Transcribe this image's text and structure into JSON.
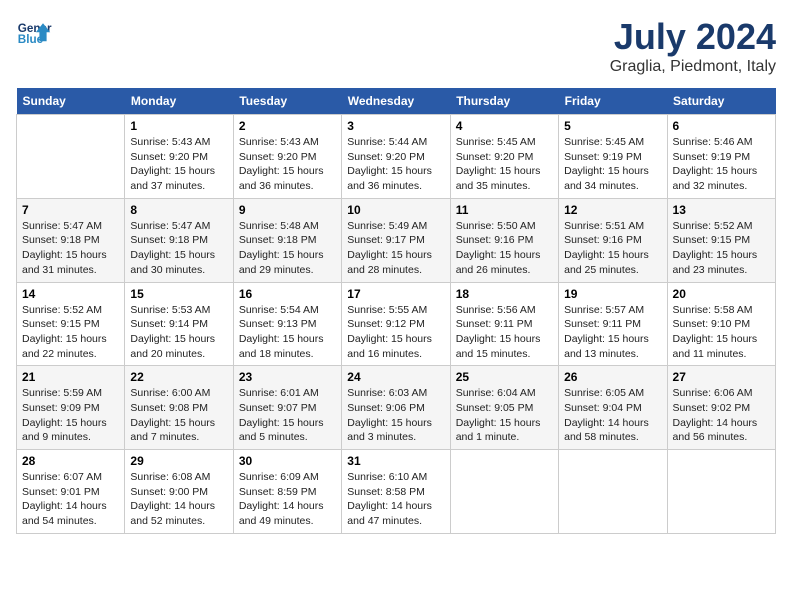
{
  "header": {
    "logo_line1": "General",
    "logo_line2": "Blue",
    "title": "July 2024",
    "subtitle": "Graglia, Piedmont, Italy"
  },
  "days_of_week": [
    "Sunday",
    "Monday",
    "Tuesday",
    "Wednesday",
    "Thursday",
    "Friday",
    "Saturday"
  ],
  "weeks": [
    [
      {
        "day": "",
        "info": ""
      },
      {
        "day": "1",
        "info": "Sunrise: 5:43 AM\nSunset: 9:20 PM\nDaylight: 15 hours\nand 37 minutes."
      },
      {
        "day": "2",
        "info": "Sunrise: 5:43 AM\nSunset: 9:20 PM\nDaylight: 15 hours\nand 36 minutes."
      },
      {
        "day": "3",
        "info": "Sunrise: 5:44 AM\nSunset: 9:20 PM\nDaylight: 15 hours\nand 36 minutes."
      },
      {
        "day": "4",
        "info": "Sunrise: 5:45 AM\nSunset: 9:20 PM\nDaylight: 15 hours\nand 35 minutes."
      },
      {
        "day": "5",
        "info": "Sunrise: 5:45 AM\nSunset: 9:19 PM\nDaylight: 15 hours\nand 34 minutes."
      },
      {
        "day": "6",
        "info": "Sunrise: 5:46 AM\nSunset: 9:19 PM\nDaylight: 15 hours\nand 32 minutes."
      }
    ],
    [
      {
        "day": "7",
        "info": "Sunrise: 5:47 AM\nSunset: 9:18 PM\nDaylight: 15 hours\nand 31 minutes."
      },
      {
        "day": "8",
        "info": "Sunrise: 5:47 AM\nSunset: 9:18 PM\nDaylight: 15 hours\nand 30 minutes."
      },
      {
        "day": "9",
        "info": "Sunrise: 5:48 AM\nSunset: 9:18 PM\nDaylight: 15 hours\nand 29 minutes."
      },
      {
        "day": "10",
        "info": "Sunrise: 5:49 AM\nSunset: 9:17 PM\nDaylight: 15 hours\nand 28 minutes."
      },
      {
        "day": "11",
        "info": "Sunrise: 5:50 AM\nSunset: 9:16 PM\nDaylight: 15 hours\nand 26 minutes."
      },
      {
        "day": "12",
        "info": "Sunrise: 5:51 AM\nSunset: 9:16 PM\nDaylight: 15 hours\nand 25 minutes."
      },
      {
        "day": "13",
        "info": "Sunrise: 5:52 AM\nSunset: 9:15 PM\nDaylight: 15 hours\nand 23 minutes."
      }
    ],
    [
      {
        "day": "14",
        "info": "Sunrise: 5:52 AM\nSunset: 9:15 PM\nDaylight: 15 hours\nand 22 minutes."
      },
      {
        "day": "15",
        "info": "Sunrise: 5:53 AM\nSunset: 9:14 PM\nDaylight: 15 hours\nand 20 minutes."
      },
      {
        "day": "16",
        "info": "Sunrise: 5:54 AM\nSunset: 9:13 PM\nDaylight: 15 hours\nand 18 minutes."
      },
      {
        "day": "17",
        "info": "Sunrise: 5:55 AM\nSunset: 9:12 PM\nDaylight: 15 hours\nand 16 minutes."
      },
      {
        "day": "18",
        "info": "Sunrise: 5:56 AM\nSunset: 9:11 PM\nDaylight: 15 hours\nand 15 minutes."
      },
      {
        "day": "19",
        "info": "Sunrise: 5:57 AM\nSunset: 9:11 PM\nDaylight: 15 hours\nand 13 minutes."
      },
      {
        "day": "20",
        "info": "Sunrise: 5:58 AM\nSunset: 9:10 PM\nDaylight: 15 hours\nand 11 minutes."
      }
    ],
    [
      {
        "day": "21",
        "info": "Sunrise: 5:59 AM\nSunset: 9:09 PM\nDaylight: 15 hours\nand 9 minutes."
      },
      {
        "day": "22",
        "info": "Sunrise: 6:00 AM\nSunset: 9:08 PM\nDaylight: 15 hours\nand 7 minutes."
      },
      {
        "day": "23",
        "info": "Sunrise: 6:01 AM\nSunset: 9:07 PM\nDaylight: 15 hours\nand 5 minutes."
      },
      {
        "day": "24",
        "info": "Sunrise: 6:03 AM\nSunset: 9:06 PM\nDaylight: 15 hours\nand 3 minutes."
      },
      {
        "day": "25",
        "info": "Sunrise: 6:04 AM\nSunset: 9:05 PM\nDaylight: 15 hours\nand 1 minute."
      },
      {
        "day": "26",
        "info": "Sunrise: 6:05 AM\nSunset: 9:04 PM\nDaylight: 14 hours\nand 58 minutes."
      },
      {
        "day": "27",
        "info": "Sunrise: 6:06 AM\nSunset: 9:02 PM\nDaylight: 14 hours\nand 56 minutes."
      }
    ],
    [
      {
        "day": "28",
        "info": "Sunrise: 6:07 AM\nSunset: 9:01 PM\nDaylight: 14 hours\nand 54 minutes."
      },
      {
        "day": "29",
        "info": "Sunrise: 6:08 AM\nSunset: 9:00 PM\nDaylight: 14 hours\nand 52 minutes."
      },
      {
        "day": "30",
        "info": "Sunrise: 6:09 AM\nSunset: 8:59 PM\nDaylight: 14 hours\nand 49 minutes."
      },
      {
        "day": "31",
        "info": "Sunrise: 6:10 AM\nSunset: 8:58 PM\nDaylight: 14 hours\nand 47 minutes."
      },
      {
        "day": "",
        "info": ""
      },
      {
        "day": "",
        "info": ""
      },
      {
        "day": "",
        "info": ""
      }
    ]
  ]
}
